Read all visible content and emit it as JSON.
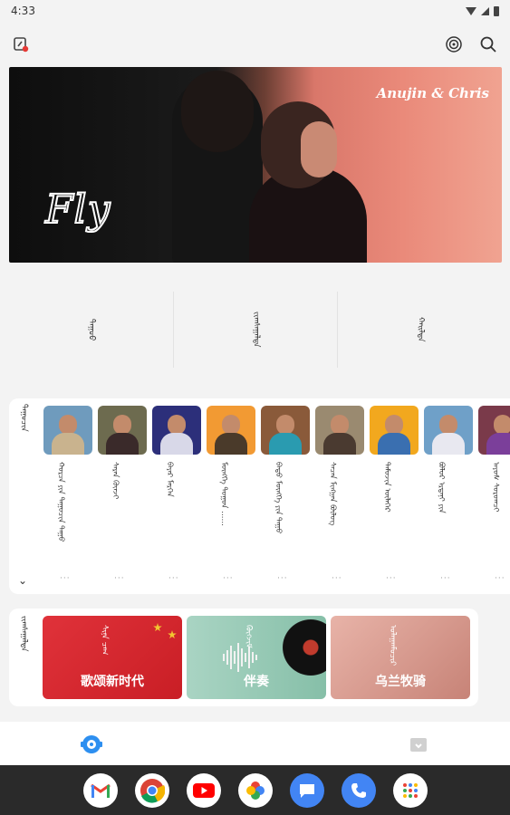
{
  "status_bar": {
    "time": "4:33"
  },
  "top_bar": {
    "logo_icon": "music-logo-icon",
    "radar_icon": "radar-icon",
    "search_icon": "search-icon"
  },
  "banner": {
    "title": "Fly",
    "artist": "Anujin & Chris"
  },
  "categories": [
    {
      "label": "ᠳᠠᠭᠤᠤ"
    },
    {
      "label": "ᠵᠢᠭᠰᠠᠭᠠᠯᠲᠠ"
    },
    {
      "label": "ᠬᠠᠢᠯᠲᠠ"
    }
  ],
  "artists": {
    "title": "ᠳᠠᠭᠤᠴᠢᠨ",
    "more_label": "···",
    "items": [
      {
        "name": "ᠬᠤᠷᠴᠠ ᠶᠢᠨ ᠳᠠᠭᠤᠴᠢᠨ ᠳᠠᠭᠤ",
        "bg": "#6f9bbd",
        "body": "#c9b38e"
      },
      {
        "name": "ᠰᠠᠷᠠᠨ ᠭᠦᠨᠵᠢ",
        "bg": "#6d6b4f",
        "body": "#3a2a2a"
      },
      {
        "name": "ᠪᠠᠶᠠᠷ ᠮᠡᠷᠭᠡᠨ",
        "bg": "#2c2f7a",
        "body": "#d8d8e8"
      },
      {
        "name": "ᠮᠦᠩᠭᠡ ᠲᠣᠭᠣᠨ ……",
        "bg": "#f29a33",
        "body": "#4a3a2a"
      },
      {
        "name": "ᠪᠠᠲᠤ ᠮᠥᠩᠬᠡ ᠶᠢᠨ ᠳᠠᠭᠤ",
        "bg": "#8a5a3a",
        "body": "#2a9bb0"
      },
      {
        "name": "ᠰᠡᠴᠡᠨ ᠮᠢᠩᠭᠠᠨ ᠪᠦᠯᠦᠭ",
        "bg": "#9a8a70",
        "body": "#4a3a30"
      },
      {
        "name": "ᠲᠡᠮᠦᠵᠢᠨ ᠦᠯᠡᠭᠡᠷ",
        "bg": "#f2a81e",
        "body": "#3a6fb0"
      },
      {
        "name": "ᠪᠣᠯᠣᠷ ᠡᠷᠳᠡᠨᠢ ᠶᠢᠨ",
        "bg": "#6fa0c8",
        "body": "#e8e8f0"
      },
      {
        "name": "ᠠᠶᠣᠰ ᠰᠤᠷᠤᠭᠴᠢ",
        "bg": "#7a3a4a",
        "body": "#7b3f9a"
      }
    ]
  },
  "playlists": {
    "title": "ᠵᠢᠭᠰᠠᠭᠠᠯᠲᠠ",
    "items": [
      {
        "script": "ᠰᠢᠨᠡ ᠴᠠᠭ",
        "caption": "歌颂新时代"
      },
      {
        "script": "ᠬᠥᠭᠵᠢᠮ",
        "caption": "伴奏"
      },
      {
        "script": "ᠤᠯᠠᠭᠠᠨᠮᠤᠴᠢᠷ",
        "caption": "乌兰牧骑"
      }
    ]
  },
  "bottom_nav": {
    "home_icon": "home-music-icon",
    "library_icon": "library-icon"
  },
  "dock": {
    "apps": [
      "gmail-icon",
      "chrome-icon",
      "youtube-icon",
      "photos-icon",
      "messages-icon",
      "phone-icon",
      "app-drawer-icon"
    ]
  },
  "colors": {
    "accent": "#2d8ff0",
    "playlist_red": "#d9262e"
  }
}
